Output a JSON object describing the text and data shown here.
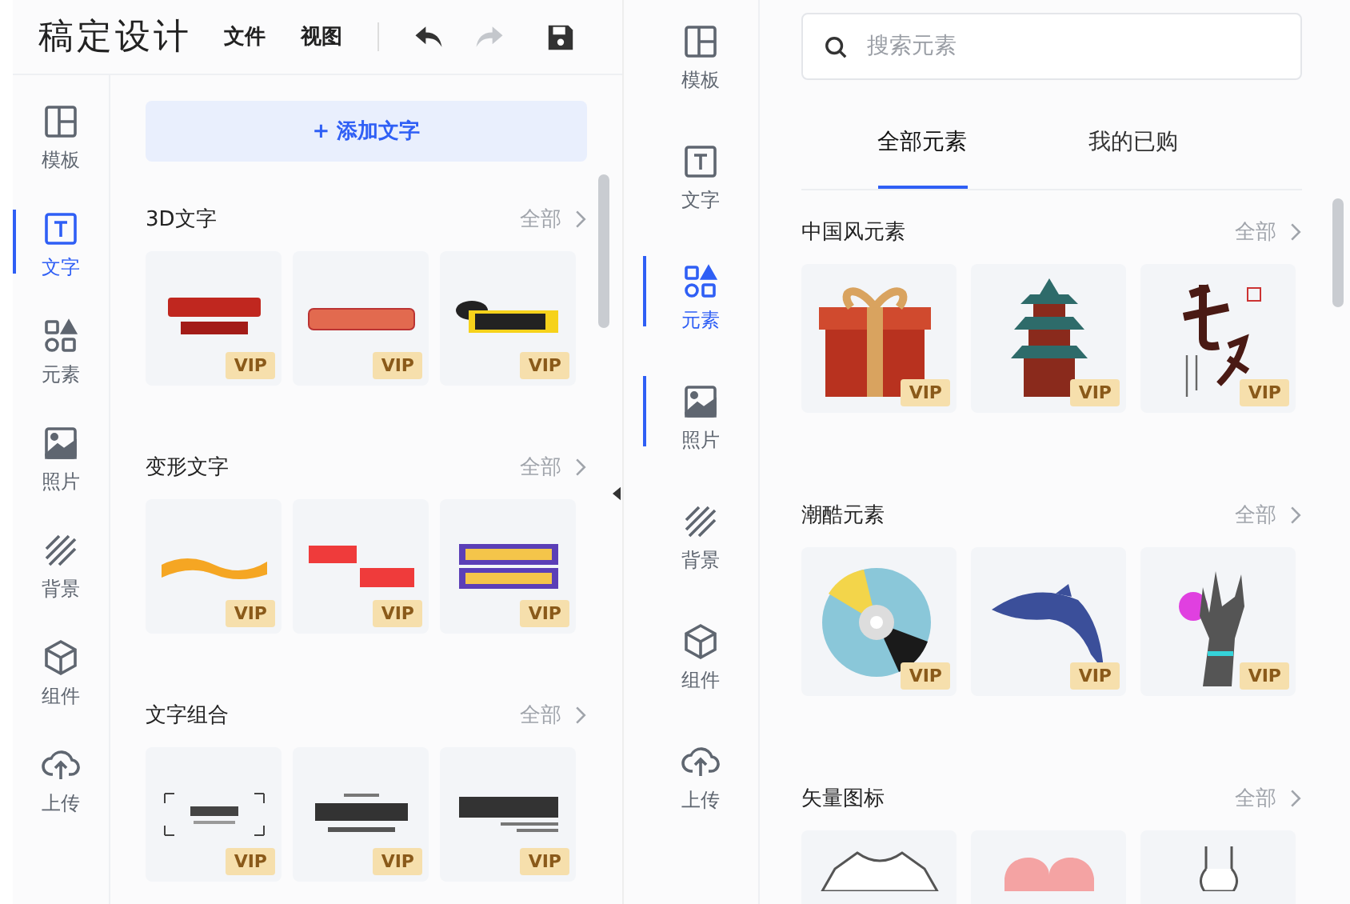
{
  "left_panel": {
    "app_title": "稿定设计",
    "menu": [
      "文件",
      "视图"
    ],
    "undo": {
      "disabled": false
    },
    "redo": {
      "disabled": true
    },
    "sidebar": [
      {
        "kind": "template",
        "label": "模板",
        "selected": false
      },
      {
        "kind": "text",
        "label": "文字",
        "selected": true
      },
      {
        "kind": "elements",
        "label": "元素",
        "selected": false
      },
      {
        "kind": "photo",
        "label": "照片",
        "selected": false
      },
      {
        "kind": "background",
        "label": "背景",
        "selected": false
      },
      {
        "kind": "component",
        "label": "组件",
        "selected": false
      },
      {
        "kind": "upload",
        "label": "上传",
        "selected": false
      }
    ],
    "add_text_button": "+ 添加文字",
    "sections": [
      {
        "title": "3D文字",
        "more": "全部",
        "cards": [
          {
            "kind": "banner",
            "badge": "VIP"
          },
          {
            "kind": "ribbon",
            "badge": "VIP"
          },
          {
            "kind": "tag",
            "badge": "VIP"
          }
        ]
      },
      {
        "title": "变形文字",
        "more": "全部",
        "cards": [
          {
            "kind": "wave",
            "badge": "VIP"
          },
          {
            "kind": "slant",
            "badge": "VIP"
          },
          {
            "kind": "block",
            "badge": "VIP"
          }
        ]
      },
      {
        "title": "文字组合",
        "more": "全部",
        "cards": [
          {
            "kind": "frame",
            "badge": "VIP"
          },
          {
            "kind": "title",
            "badge": "VIP"
          },
          {
            "kind": "lines",
            "badge": "VIP"
          }
        ]
      }
    ]
  },
  "right_panel": {
    "sidebar": [
      {
        "kind": "template",
        "label": "模板",
        "selected": false,
        "indicator": false
      },
      {
        "kind": "text",
        "label": "文字",
        "selected": false,
        "indicator": false
      },
      {
        "kind": "elements",
        "label": "元素",
        "selected": true,
        "indicator": true
      },
      {
        "kind": "photo",
        "label": "照片",
        "selected": false,
        "indicator": true
      },
      {
        "kind": "background",
        "label": "背景",
        "selected": false,
        "indicator": false
      },
      {
        "kind": "component",
        "label": "组件",
        "selected": false,
        "indicator": false
      },
      {
        "kind": "upload",
        "label": "上传",
        "selected": false,
        "indicator": false
      }
    ],
    "search": {
      "placeholder": "搜索元素"
    },
    "tabs": [
      {
        "label": "全部元素",
        "selected": true
      },
      {
        "label": "我的已购",
        "selected": false
      }
    ],
    "sections": [
      {
        "title": "中国风元素",
        "more": "全部",
        "cards": [
          {
            "kind": "gift",
            "badge": "VIP"
          },
          {
            "kind": "pagoda",
            "badge": "VIP"
          },
          {
            "kind": "calligraphy",
            "badge": "VIP"
          }
        ]
      },
      {
        "title": "潮酷元素",
        "more": "全部",
        "cards": [
          {
            "kind": "disc",
            "badge": "VIP"
          },
          {
            "kind": "dolphin",
            "badge": "VIP"
          },
          {
            "kind": "hand",
            "badge": "VIP"
          }
        ]
      },
      {
        "title": "矢量图标",
        "more": "全部",
        "cards": [
          {
            "kind": "tshirt"
          },
          {
            "kind": "heart"
          },
          {
            "kind": "dress"
          }
        ]
      }
    ]
  }
}
